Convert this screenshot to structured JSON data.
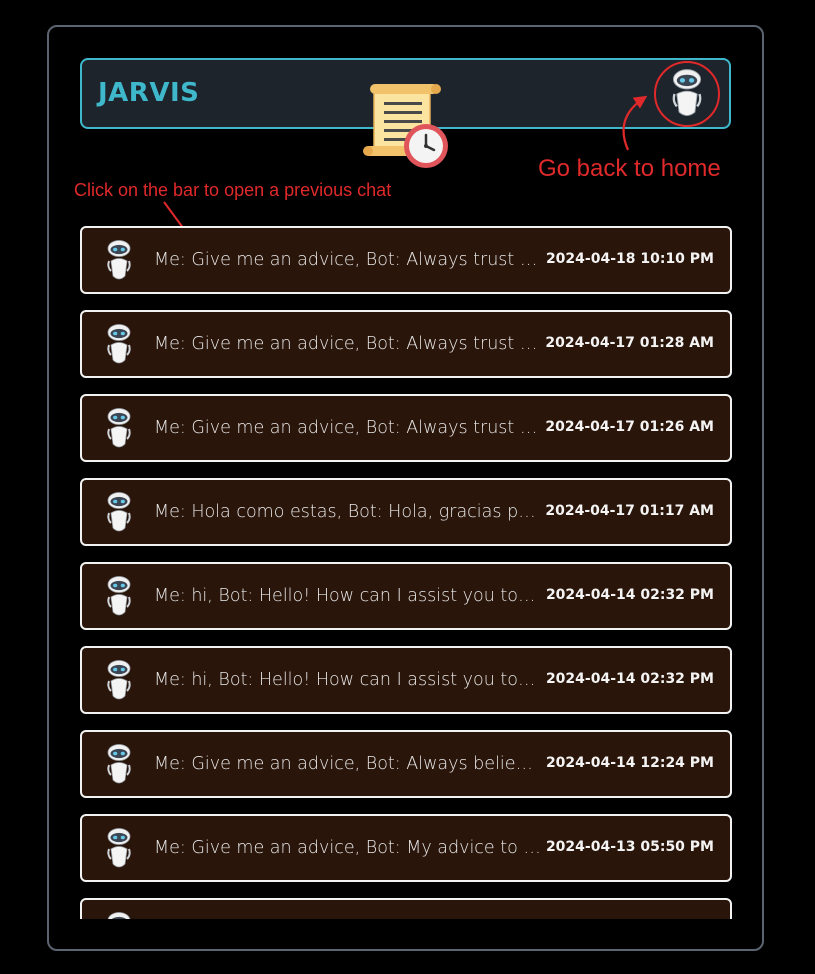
{
  "header": {
    "title": "JARVIS",
    "accent_color": "#3fb8cc",
    "history_icon": "scroll-clock-icon",
    "home_icon": "robot-avatar-icon"
  },
  "annotations": {
    "home_hint": "Go back to home",
    "bar_hint": "Click on the bar to open a previous chat",
    "color": "#e0292a"
  },
  "chats": [
    {
      "preview": "Me: Give me an advice, Bot: Always trust yourself and your abilities",
      "timestamp": "2024-04-18 10:10 PM"
    },
    {
      "preview": "Me: Give me an advice, Bot: Always trust yourself and your abilities",
      "timestamp": "2024-04-17 01:28 AM"
    },
    {
      "preview": "Me: Give me an advice, Bot: Always trust yourself and your abilities",
      "timestamp": "2024-04-17 01:26 AM"
    },
    {
      "preview": "Me: Hola como estas, Bot: Hola, gracias por preguntar",
      "timestamp": "2024-04-17 01:17 AM"
    },
    {
      "preview": "Me: hi, Bot: Hello! How can I assist you today?",
      "timestamp": "2024-04-14 02:32 PM"
    },
    {
      "preview": "Me: hi, Bot: Hello! How can I assist you today?",
      "timestamp": "2024-04-14 02:32 PM"
    },
    {
      "preview": "Me: Give me an advice, Bot: Always believe in yourself",
      "timestamp": "2024-04-14 12:24 PM"
    },
    {
      "preview": "Me: Give me an advice, Bot: My advice to you is",
      "timestamp": "2024-04-13 05:50 PM"
    },
    {
      "preview": "",
      "timestamp": ""
    }
  ]
}
